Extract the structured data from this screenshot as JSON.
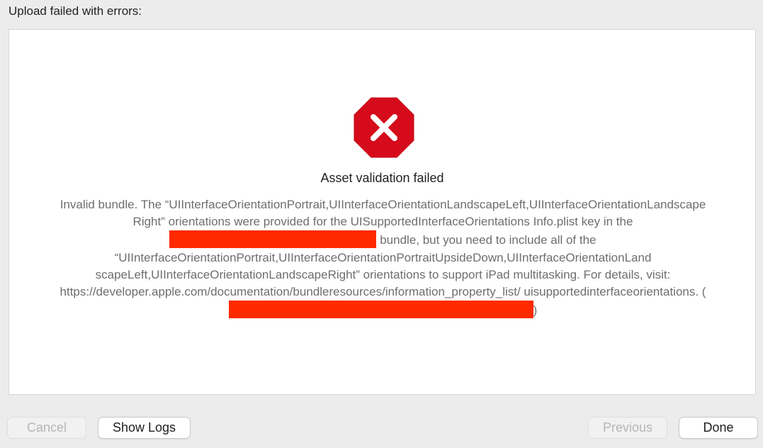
{
  "header": {
    "title": "Upload failed with errors:"
  },
  "error": {
    "icon": "error-octagon-icon",
    "icon_color": "#d50b1b",
    "title": "Asset validation failed",
    "message": {
      "part1": "Invalid bundle. The “UIInterfaceOrientationPortrait,UIInterfaceOrientationLandscapeLeft,UIInterfaceOrientationLandscape Right” orientations were provided for the UISupportedInterfaceOrientations Info.plist key in the",
      "part2": "bundle, but you need to include all of the “UIInterfaceOrientationPortrait,UIInterfaceOrientationPortraitUpsideDown,UIInterfaceOrientationLand scapeLeft,UIInterfaceOrientationLandscapeRight” orientations to support iPad multitasking. For details, visit: https://developer.apple.com/documentation/bundleresources/information_property_list/ uisupportedinterfaceorientations. (",
      "part3": ")"
    },
    "redaction_color": "#ff2a00"
  },
  "buttons": {
    "cancel": "Cancel",
    "show_logs": "Show Logs",
    "previous": "Previous",
    "done": "Done"
  }
}
